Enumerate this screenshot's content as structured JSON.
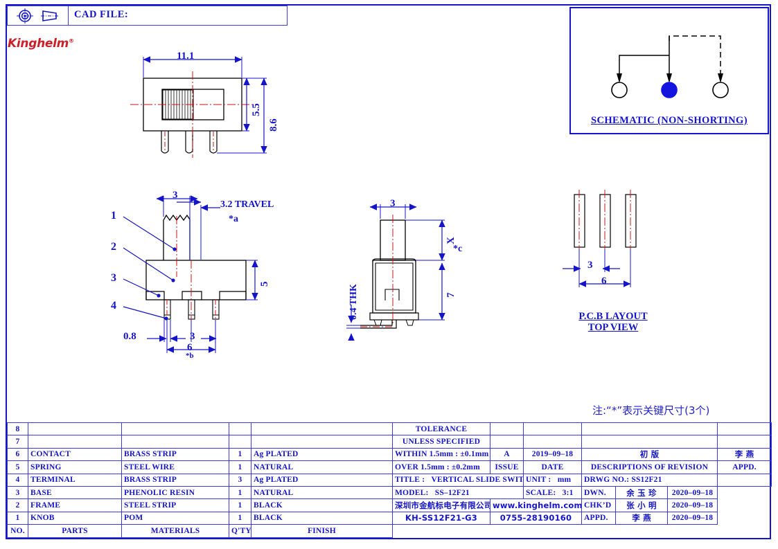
{
  "header": {
    "cad_file_label": "CAD FILE:",
    "projection_symbol_icons": [
      "target-icon",
      "cone-icon"
    ]
  },
  "brand": {
    "logo_text": "Kinghelm",
    "registered_mark": "®",
    "logo_color": "#cc2029"
  },
  "schematic": {
    "title": "SCHEMATIC (NON-SHORTING)",
    "terminals": [
      "open",
      "filled",
      "open"
    ],
    "filled_color": "#1414e0"
  },
  "front_view": {
    "dim_width": "11.1",
    "dim_height_inner": "5.5",
    "dim_height_total": "8.6"
  },
  "side_view": {
    "callouts": [
      "1",
      "2",
      "3",
      "4"
    ],
    "dim_knob_width": "3",
    "dim_travel": "3.2  TRAVEL",
    "travel_key": "*a",
    "dim_body_height": "5",
    "dim_lead_width": "0.8",
    "dim_pitch": "3",
    "dim_span": "6",
    "span_key": "*b"
  },
  "profile_view": {
    "dim_width": "3",
    "dim_x": "X",
    "x_key": "*c",
    "dim_thickness": "0.4  THK",
    "dim_height": "7"
  },
  "pcb_layout": {
    "title_line1": "P.C.B  LAYOUT",
    "title_line2": "TOP  VIEW",
    "dim_pitch": "3",
    "dim_span": "6"
  },
  "note": "注:“*”表示关键尺寸(3个)",
  "bom": {
    "headers": [
      "NO.",
      "PARTS",
      "MATERIALS",
      "Q'TY",
      "FINISH"
    ],
    "rows": [
      {
        "no": "8",
        "part": "",
        "material": "",
        "qty": "",
        "finish": ""
      },
      {
        "no": "7",
        "part": "",
        "material": "",
        "qty": "",
        "finish": ""
      },
      {
        "no": "6",
        "part": "CONTACT",
        "material": "BRASS  STRIP",
        "qty": "1",
        "finish": "Ag  PLATED"
      },
      {
        "no": "5",
        "part": "SPRING",
        "material": "STEEL  WIRE",
        "qty": "1",
        "finish": "NATURAL"
      },
      {
        "no": "4",
        "part": "TERMINAL",
        "material": "BRASS  STRIP",
        "qty": "3",
        "finish": "Ag  PLATED"
      },
      {
        "no": "3",
        "part": "BASE",
        "material": "PHENOLIC  RESIN",
        "qty": "1",
        "finish": "NATURAL"
      },
      {
        "no": "2",
        "part": "FRAME",
        "material": "STEEL  STRIP",
        "qty": "1",
        "finish": "BLACK"
      },
      {
        "no": "1",
        "part": "KNOB",
        "material": "POM",
        "qty": "1",
        "finish": "BLACK"
      }
    ]
  },
  "titleblock": {
    "tolerance_line1": "TOLERANCE",
    "tolerance_line2": "UNLESS   SPECIFIED",
    "tol_within": "WITHIN 1.5mm : ±0.1mm",
    "tol_over": "OVER 1.5mm : ±0.2mm",
    "issue_value": "A",
    "issue_label": "ISSUE",
    "date_value": "2019‒09‒18",
    "date_label": "DATE",
    "revision_value": "初  版",
    "revision_label": "DESCRIPTIONS  OF  REVISION",
    "appd_value": "李 燕",
    "appd_label": "APPD.",
    "title_label": "TITLE :",
    "title_value": "VERTICAL  SLIDE  SWITCH",
    "model_label": "MODEL:",
    "model_value": "SS‒12F21",
    "unit_label": "UNIT :",
    "unit_value": "mm",
    "scale_label": "SCALE:",
    "scale_value": "3:1",
    "drwg_no": "DRWG NO.: SS12F21",
    "dwn_label": "DWN.",
    "dwn_name": "余 玉 珍",
    "dwn_date": "2020‒09‒18",
    "chkd_label": "CHK’D",
    "chkd_name": "张 小 明",
    "chkd_date": "2020‒09‒18",
    "appd2_label": "APPD.",
    "appd2_name": "李  燕",
    "appd2_date": "2020‒09‒18",
    "company_cn": "深圳市金航标电子有限公司",
    "website": "www.kinghelm.com.cn",
    "part_number": "KH-SS12F21-G3",
    "phone": "0755-28190160"
  }
}
